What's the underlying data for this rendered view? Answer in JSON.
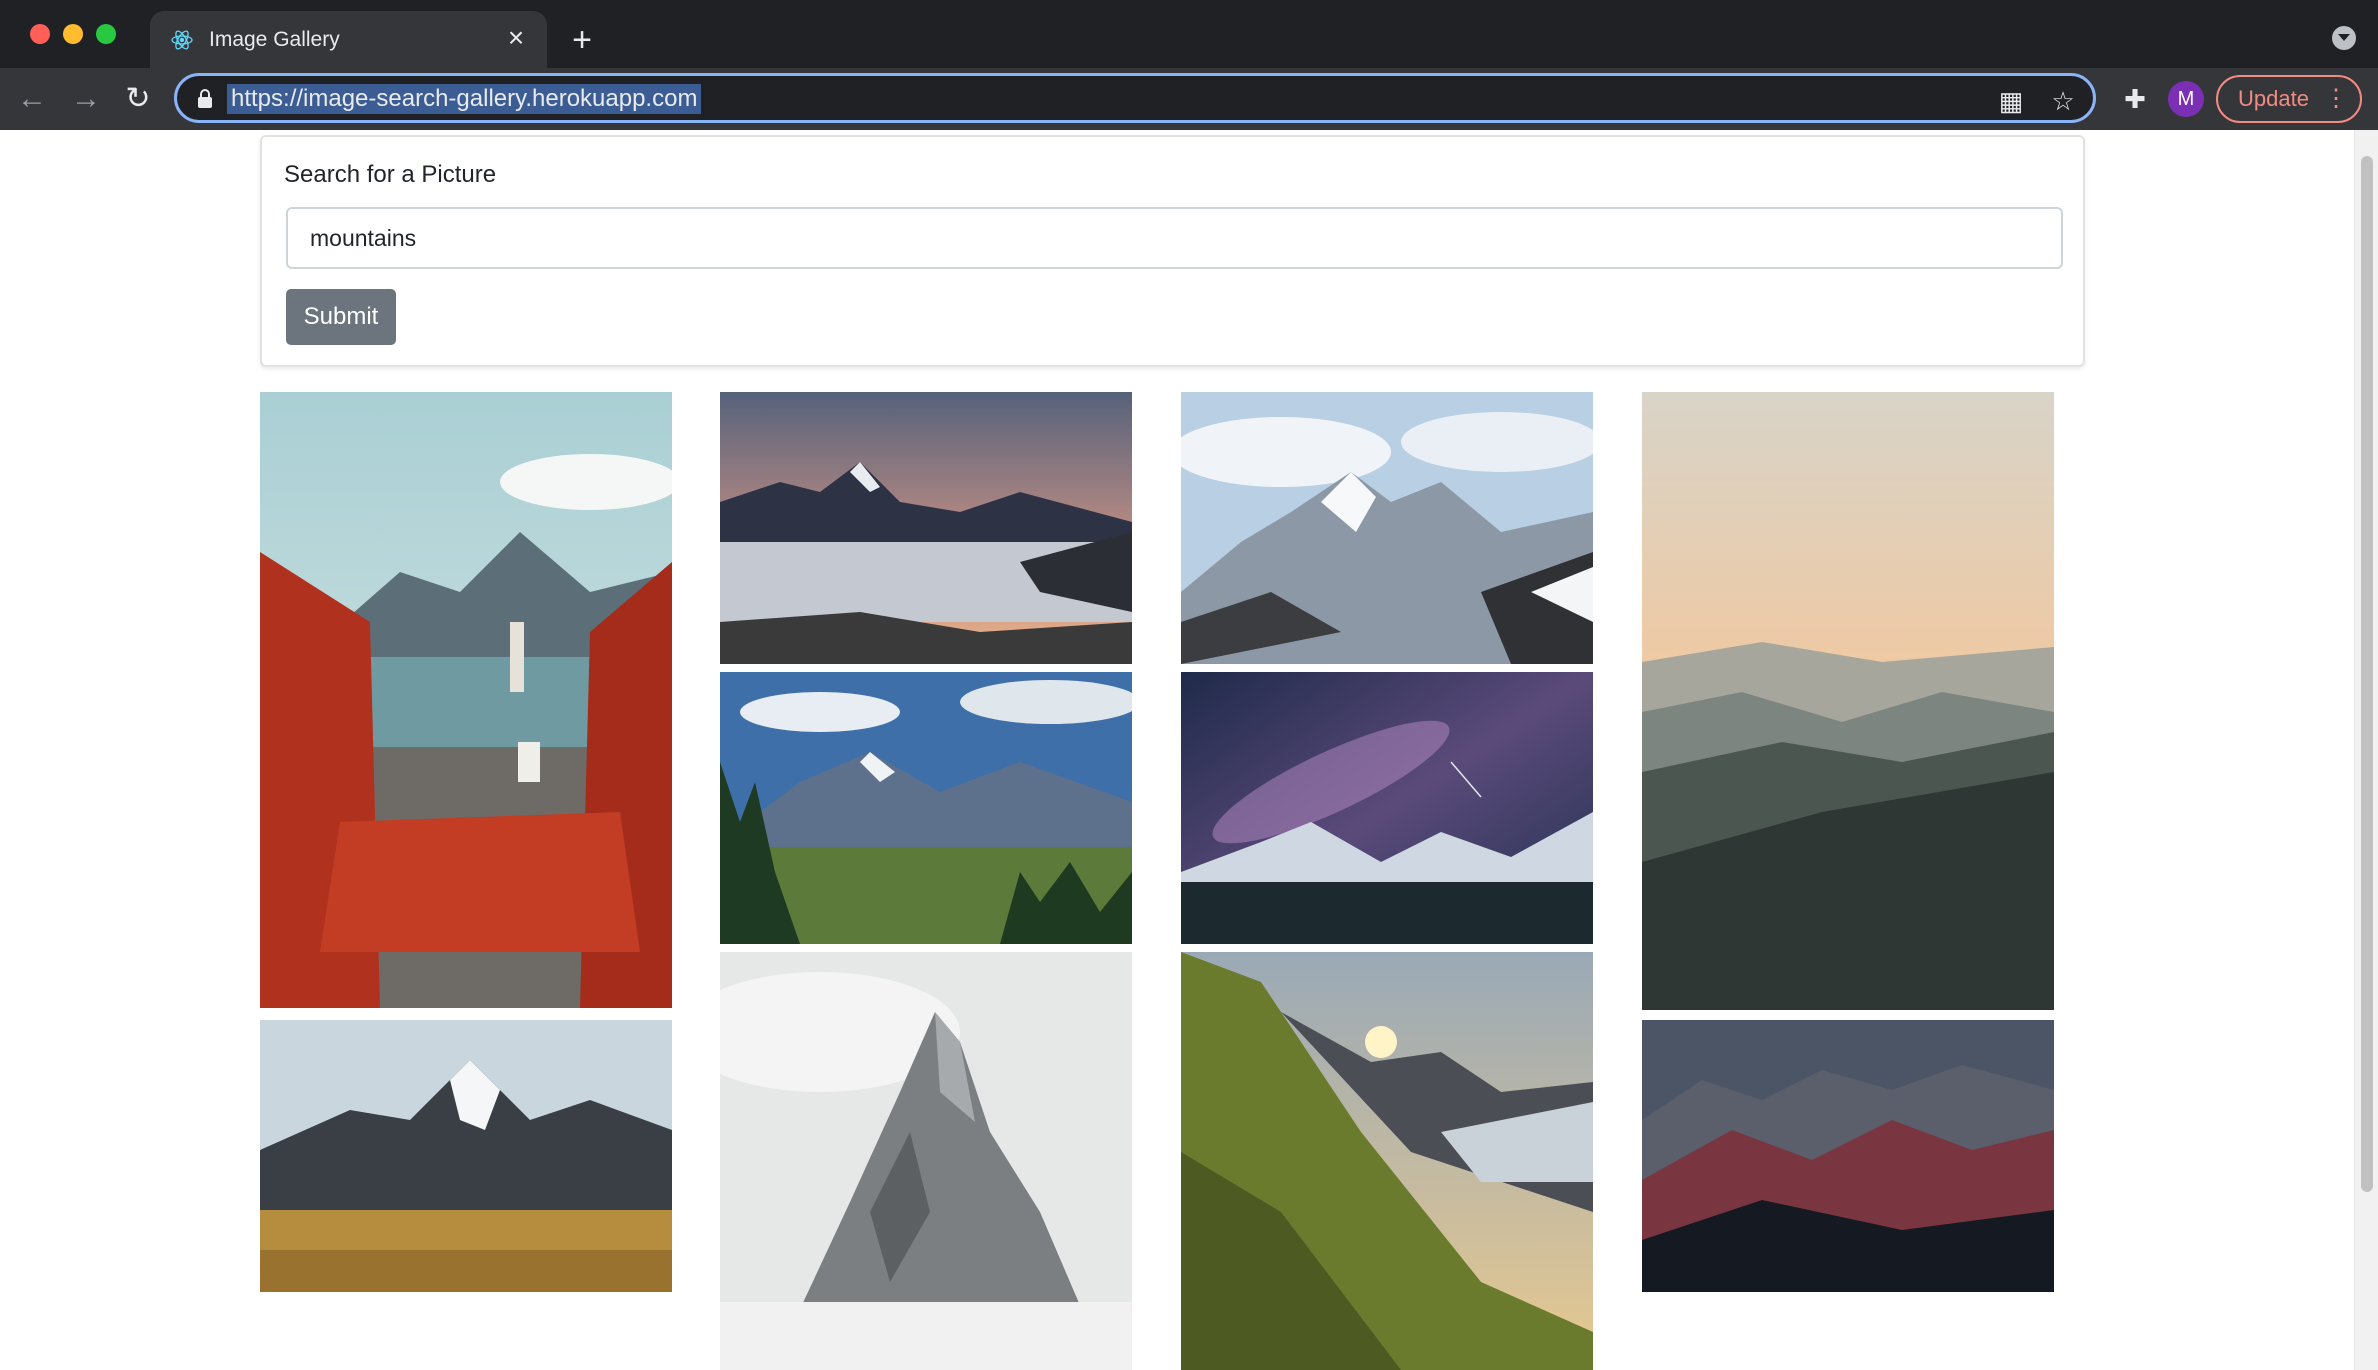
{
  "browser": {
    "tab_title": "Image Gallery",
    "url": "https://image-search-gallery.herokuapp.com",
    "profile_initial": "M",
    "update_label": "Update"
  },
  "search": {
    "label": "Search for a Picture",
    "value": "mountains",
    "submit_label": "Submit"
  },
  "gallery": {
    "columns": 4,
    "image_count": 11
  }
}
